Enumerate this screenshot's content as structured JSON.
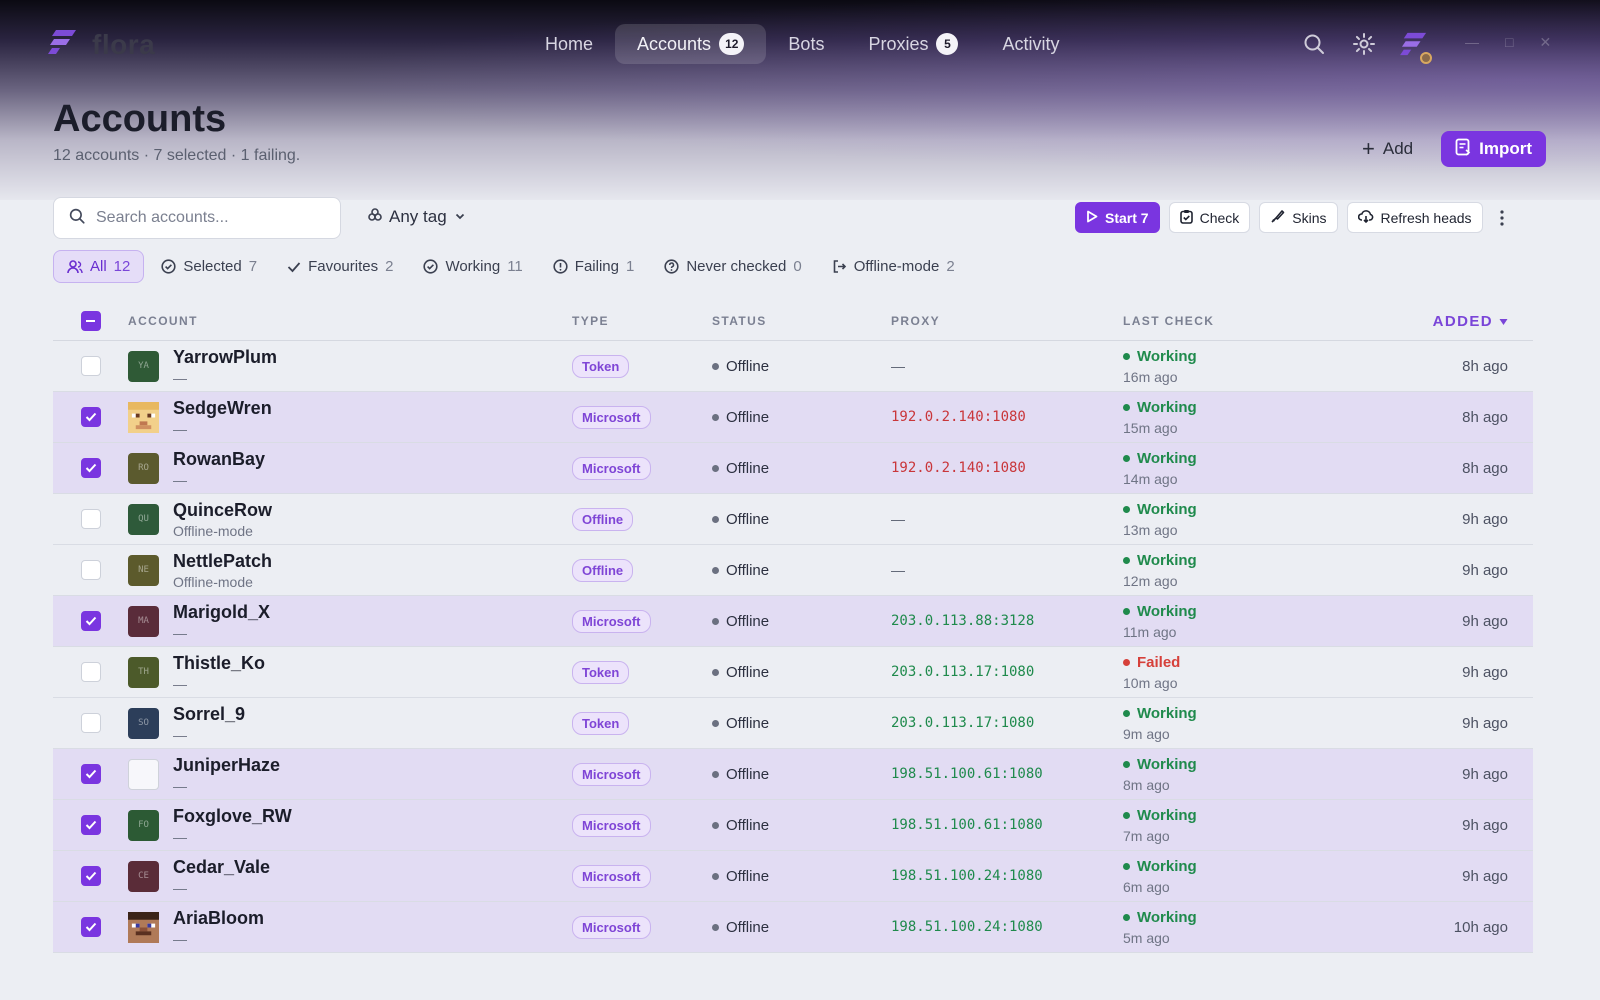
{
  "app": {
    "name": "flora"
  },
  "nav": [
    {
      "label": "Home",
      "badge": "",
      "active": false
    },
    {
      "label": "Accounts",
      "badge": "12",
      "active": true
    },
    {
      "label": "Bots",
      "badge": "",
      "active": false
    },
    {
      "label": "Proxies",
      "badge": "5",
      "active": false
    },
    {
      "label": "Activity",
      "badge": "",
      "active": false
    }
  ],
  "page": {
    "title": "Accounts",
    "subtitle": "12 accounts · 7 selected · 1 failing.",
    "add_label": "Add",
    "import_label": "Import"
  },
  "toolbar": {
    "search_placeholder": "Search accounts...",
    "tag_filter": "Any tag",
    "start_label": "Start 7",
    "check_label": "Check",
    "skins_label": "Skins",
    "refresh_label": "Refresh heads"
  },
  "filters": [
    {
      "label": "All",
      "count": "12",
      "icon": "users-icon",
      "active": true
    },
    {
      "label": "Selected",
      "count": "7",
      "icon": "check-circle-icon",
      "active": false
    },
    {
      "label": "Favourites",
      "count": "2",
      "icon": "check-icon",
      "active": false
    },
    {
      "label": "Working",
      "count": "11",
      "icon": "check-circle-icon",
      "active": false
    },
    {
      "label": "Failing",
      "count": "1",
      "icon": "alert-circle-icon",
      "active": false
    },
    {
      "label": "Never checked",
      "count": "0",
      "icon": "question-circle-icon",
      "active": false
    },
    {
      "label": "Offline-mode",
      "count": "2",
      "icon": "logout-icon",
      "active": false
    }
  ],
  "columns": {
    "account": "ACCOUNT",
    "type": "TYPE",
    "status": "STATUS",
    "proxy": "PROXY",
    "last_check": "LAST CHECK",
    "added": "ADDED"
  },
  "colors": {
    "accent": "#7a35e0",
    "working": "#1f8a4c",
    "failed": "#d6403a",
    "proxy_warn": "#c9363a",
    "proxy_ok": "#1f8a4c"
  },
  "rows": [
    {
      "name": "YarrowPlum",
      "sub": "—",
      "initials": "YA",
      "avatar_color": "#2f5a36",
      "type": "Token",
      "status": "Offline",
      "proxy": "—",
      "proxy_kind": "none",
      "check": "Working",
      "check_ok": true,
      "check_time": "16m ago",
      "added": "8h ago",
      "selected": false
    },
    {
      "name": "SedgeWren",
      "sub": "—",
      "initials": "",
      "avatar_color": "#e8c07a",
      "type": "Microsoft",
      "status": "Offline",
      "proxy": "192.0.2.140:1080",
      "proxy_kind": "warn",
      "check": "Working",
      "check_ok": true,
      "check_time": "15m ago",
      "added": "8h ago",
      "selected": true
    },
    {
      "name": "RowanBay",
      "sub": "—",
      "initials": "RO",
      "avatar_color": "#5b5a2e",
      "type": "Microsoft",
      "status": "Offline",
      "proxy": "192.0.2.140:1080",
      "proxy_kind": "warn",
      "check": "Working",
      "check_ok": true,
      "check_time": "14m ago",
      "added": "8h ago",
      "selected": true
    },
    {
      "name": "QuinceRow",
      "sub": "Offline-mode",
      "initials": "QU",
      "avatar_color": "#2e5a3a",
      "type": "Offline",
      "status": "Offline",
      "proxy": "—",
      "proxy_kind": "none",
      "check": "Working",
      "check_ok": true,
      "check_time": "13m ago",
      "added": "9h ago",
      "selected": false
    },
    {
      "name": "NettlePatch",
      "sub": "Offline-mode",
      "initials": "NE",
      "avatar_color": "#5c5a2c",
      "type": "Offline",
      "status": "Offline",
      "proxy": "—",
      "proxy_kind": "none",
      "check": "Working",
      "check_ok": true,
      "check_time": "12m ago",
      "added": "9h ago",
      "selected": false
    },
    {
      "name": "Marigold_X",
      "sub": "—",
      "initials": "MA",
      "avatar_color": "#5a2c3a",
      "type": "Microsoft",
      "status": "Offline",
      "proxy": "203.0.113.88:3128",
      "proxy_kind": "ok",
      "check": "Working",
      "check_ok": true,
      "check_time": "11m ago",
      "added": "9h ago",
      "selected": true
    },
    {
      "name": "Thistle_Ko",
      "sub": "—",
      "initials": "TH",
      "avatar_color": "#4c5a2a",
      "type": "Token",
      "status": "Offline",
      "proxy": "203.0.113.17:1080",
      "proxy_kind": "ok",
      "check": "Failed",
      "check_ok": false,
      "check_time": "10m ago",
      "added": "9h ago",
      "selected": false
    },
    {
      "name": "Sorrel_9",
      "sub": "—",
      "initials": "SO",
      "avatar_color": "#2c3e5a",
      "type": "Token",
      "status": "Offline",
      "proxy": "203.0.113.17:1080",
      "proxy_kind": "ok",
      "check": "Working",
      "check_ok": true,
      "check_time": "9m ago",
      "added": "9h ago",
      "selected": false
    },
    {
      "name": "JuniperHaze",
      "sub": "—",
      "initials": "",
      "avatar_color": "#f7f7fb",
      "type": "Microsoft",
      "status": "Offline",
      "proxy": "198.51.100.61:1080",
      "proxy_kind": "ok",
      "check": "Working",
      "check_ok": true,
      "check_time": "8m ago",
      "added": "9h ago",
      "selected": true
    },
    {
      "name": "Foxglove_RW",
      "sub": "—",
      "initials": "FO",
      "avatar_color": "#2c5a34",
      "type": "Microsoft",
      "status": "Offline",
      "proxy": "198.51.100.61:1080",
      "proxy_kind": "ok",
      "check": "Working",
      "check_ok": true,
      "check_time": "7m ago",
      "added": "9h ago",
      "selected": true
    },
    {
      "name": "Cedar_Vale",
      "sub": "—",
      "initials": "CE",
      "avatar_color": "#5a2c38",
      "type": "Microsoft",
      "status": "Offline",
      "proxy": "198.51.100.24:1080",
      "proxy_kind": "ok",
      "check": "Working",
      "check_ok": true,
      "check_time": "6m ago",
      "added": "9h ago",
      "selected": true
    },
    {
      "name": "AriaBloom",
      "sub": "—",
      "initials": "",
      "avatar_color": "#5a3a28",
      "type": "Microsoft",
      "status": "Offline",
      "proxy": "198.51.100.24:1080",
      "proxy_kind": "ok",
      "check": "Working",
      "check_ok": true,
      "check_time": "5m ago",
      "added": "10h ago",
      "selected": true
    }
  ]
}
